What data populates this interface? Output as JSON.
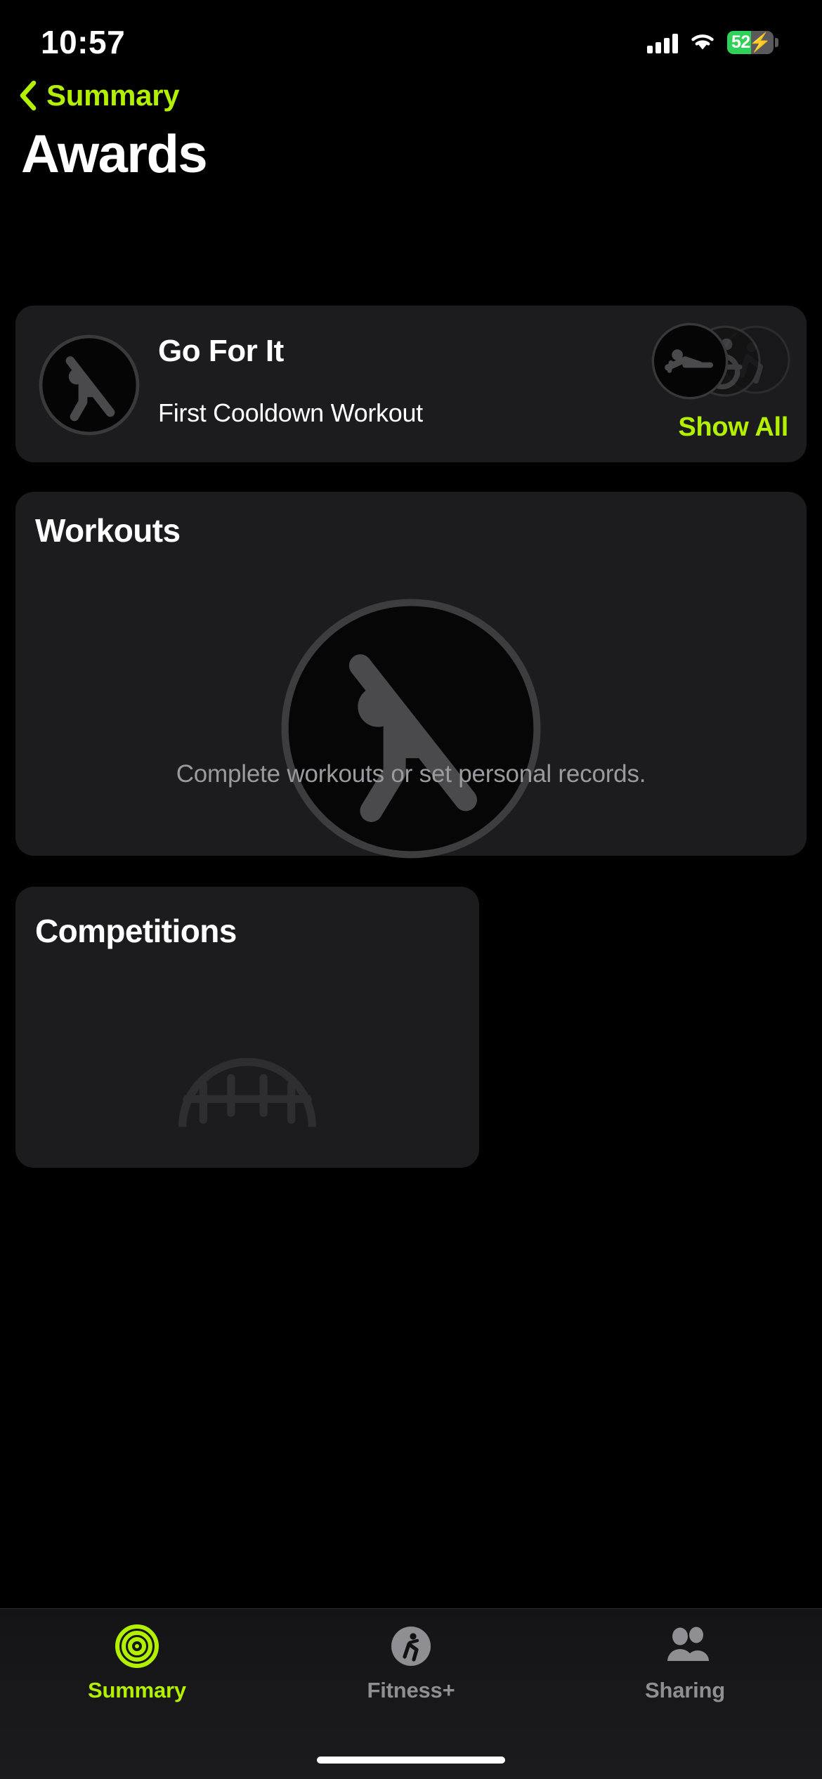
{
  "status_bar": {
    "time": "10:57",
    "signal_icon": "cellular-signal-icon",
    "wifi_icon": "wifi-icon",
    "battery_percent": "52",
    "battery_charging": true,
    "battery_fill_color": "#30d158"
  },
  "nav": {
    "back_icon": "chevron-left-icon",
    "back_label": "Summary"
  },
  "page": {
    "title": "Awards",
    "accent_color": "#b2f000",
    "background_color": "#000000",
    "card_color": "#1c1c1e"
  },
  "featured_award": {
    "badge_icon": "cooldown-stretch-badge-icon",
    "title": "Go For It",
    "subtitle": "First Cooldown Workout",
    "stack_icons": [
      "rowing-badge-icon",
      "wheelchair-badge-icon",
      "running-badge-icon"
    ],
    "show_all_label": "Show All"
  },
  "sections": [
    {
      "title": "Workouts",
      "badge_icon": "cooldown-stretch-badge-icon",
      "caption": "Complete workouts or set personal records."
    },
    {
      "title": "Competitions",
      "badge_icon": "competition-medal-badge-icon",
      "caption": ""
    }
  ],
  "tabbar": {
    "items": [
      {
        "label": "Summary",
        "icon": "activity-rings-icon",
        "active": true
      },
      {
        "label": "Fitness+",
        "icon": "running-person-icon",
        "active": false
      },
      {
        "label": "Sharing",
        "icon": "two-people-icon",
        "active": false
      }
    ]
  }
}
